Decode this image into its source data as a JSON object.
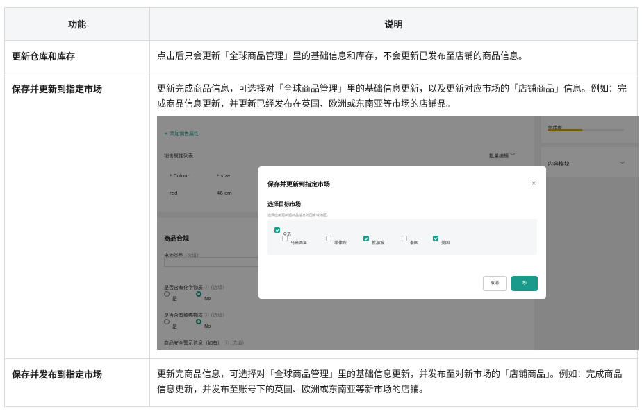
{
  "header": {
    "col1": "功能",
    "col2": "说明"
  },
  "rows": [
    {
      "feature": "更新仓库和库存",
      "desc": "点击后只会更新「全球商品管理」里的基础信息和库存，不会更新已发布至店铺的商品信息。"
    },
    {
      "feature": "保存并更新到指定市场",
      "desc": "更新完成商品信息，可选择对「全球商品管理」里的基础信息更新，以及更新对应市场的「店铺商品」信息。例如：完成商品信息更新，并更新已经发布在英国、欧洲或东南亚等市场的店铺品。"
    },
    {
      "feature": "保存并发布到指定市场",
      "desc": "更新完商品信息，可选择对「全球商品管理」里的基础信息更新，并发布至对新市场的「店铺商品」。例如：完成商品信息更新，并发布至账号下的英国、欧洲或东南亚等新市场的店铺。"
    }
  ],
  "screenshot": {
    "add_sale_attr": "+ 添加销售属性",
    "sale_attr_list": "销售属性列表",
    "bulk_edit": "批量编辑 ﹀",
    "col_colour": "* Colour",
    "col_size": "* size",
    "val_red": "red",
    "val_46cm": "46 cm",
    "completion": "完成度",
    "completion_level": 0.45,
    "content_module": "内容模块",
    "compliance": "商品合规",
    "battery_type": "电池类型",
    "optional": "(选填)",
    "chemical": "是否含有化学物质",
    "carcinogen": "是否含有致癌物质",
    "yes": "是",
    "no": "No",
    "safety_warning": "商品安全警示信息（如有）",
    "accent": "#1a9a8a",
    "modal": {
      "title": "保存并更新到指定市场",
      "close": "×",
      "section": "选择目标市场",
      "hint": "选择应用更新后商品信息的国家或地区。",
      "select_all": "全选",
      "markets": [
        {
          "label": "马来西亚",
          "checked": false
        },
        {
          "label": "菲律宾",
          "checked": false
        },
        {
          "label": "新加坡",
          "checked": true
        },
        {
          "label": "泰国",
          "checked": false
        },
        {
          "label": "美国",
          "checked": true
        }
      ],
      "cancel": "取消",
      "confirm_icon": "loading-spinner-icon"
    }
  }
}
